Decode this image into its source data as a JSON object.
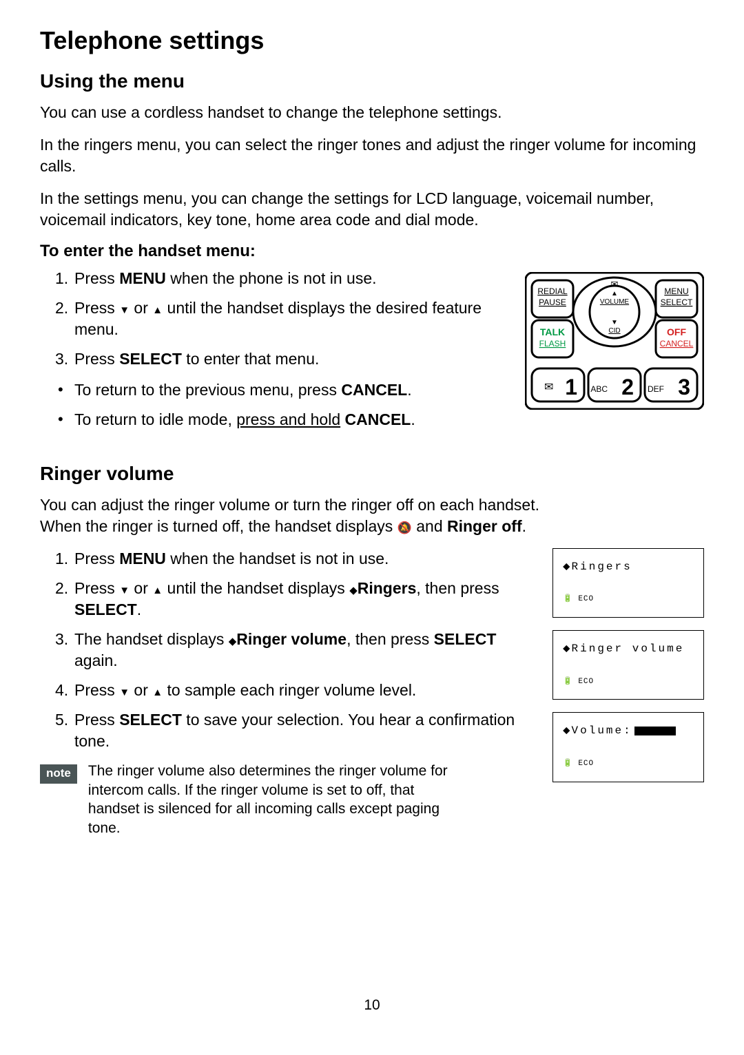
{
  "page": {
    "title": "Telephone settings",
    "number": "10"
  },
  "using_menu": {
    "heading": "Using the menu",
    "p1": "You can use a cordless handset to change the telephone settings.",
    "p2": "In the ringers menu, you can select the ringer tones and adjust the ringer volume for incoming calls.",
    "p3": "In the settings menu, you can change the settings for LCD language, voicemail number, voicemail indicators, key tone, home area code and dial mode.",
    "enter_heading": "To enter the handset menu:",
    "steps": {
      "s1_a": "Press ",
      "s1_b": "MENU",
      "s1_c": " when the phone is not in use.",
      "s2_a": "Press ",
      "s2_b": " or ",
      "s2_c": " until the handset displays the desired feature menu.",
      "s3_a": "Press ",
      "s3_b": "SELECT",
      "s3_c": " to enter that menu."
    },
    "bullets": {
      "b1_a": "To return to the previous menu, press ",
      "b1_b": "CANCEL",
      "b1_c": ".",
      "b2_a": "To return to idle mode, ",
      "b2_b": "press and hold",
      "b2_c": " ",
      "b2_d": "CANCEL",
      "b2_e": "."
    }
  },
  "ringer_volume": {
    "heading": "Ringer volume",
    "p1_a": "You can adjust the ringer volume or turn the ringer off on each handset.",
    "p1_b1": "When the ringer is turned off, the handset displays ",
    "p1_b2": " and ",
    "p1_b3": "Ringer off",
    "p1_b4": ".",
    "steps": {
      "s1_a": "Press ",
      "s1_b": "MENU",
      "s1_c": " when the handset is not in use.",
      "s2_a": "Press ",
      "s2_b": " or ",
      "s2_c": " until the handset displays ",
      "s2_d": "Ringers",
      "s2_e": ", then press ",
      "s2_f": "SELECT",
      "s2_g": ".",
      "s3_a": "The handset displays ",
      "s3_b": "Ringer volume",
      "s3_c": ", then press ",
      "s3_d": "SELECT",
      "s3_e": " again.",
      "s4_a": "Press ",
      "s4_b": " or ",
      "s4_c": " to sample each ringer volume level.",
      "s5_a": "Press ",
      "s5_b": "SELECT",
      "s5_c": " to save your selection. You hear a confirmation tone."
    }
  },
  "note": {
    "badge": "note",
    "text": "The ringer volume also determines the ringer volume for intercom calls. If the ringer volume is set to off, that handset is silenced for all incoming calls except paging tone."
  },
  "lcd": {
    "screen1": {
      "line1": "Ringers",
      "line2_icon": "🔋",
      "line2_eco": "ECO"
    },
    "screen2": {
      "line1": "Ringer volume",
      "line2_icon": "🔋",
      "line2_eco": "ECO"
    },
    "screen3": {
      "line1": "Volume:",
      "line2_icon": "🔋",
      "line2_eco": "ECO"
    }
  },
  "keypad": {
    "redial": "REDIAL",
    "pause": "PAUSE",
    "menu": "MENU",
    "select": "SELECT",
    "talk": "TALK",
    "flash": "FLASH",
    "off": "OFF",
    "cancel": "CANCEL",
    "volume": "VOLUME",
    "cid": "CID",
    "key1": "1",
    "key2": "2",
    "key2abc": "ABC",
    "key3": "3",
    "key3def": "DEF"
  }
}
